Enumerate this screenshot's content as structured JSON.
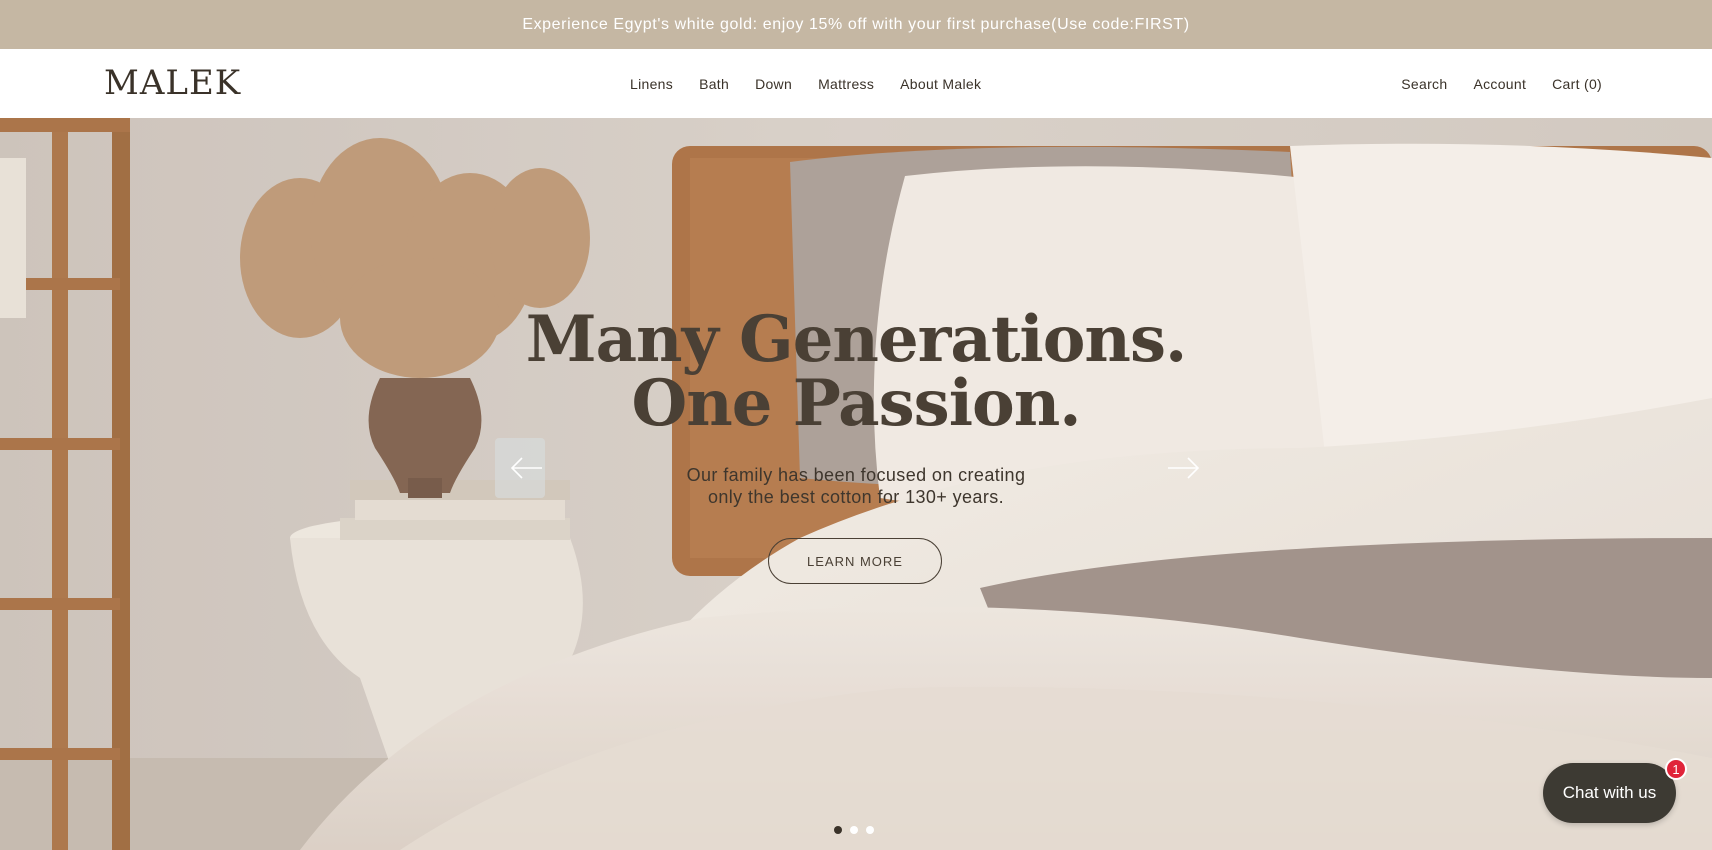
{
  "announcement": {
    "text": "Experience Egypt's white gold: enjoy 15% off with your first purchase(Use code:FIRST)"
  },
  "header": {
    "logo": "MALEK",
    "nav": [
      "Linens",
      "Bath",
      "Down",
      "Mattress",
      "About Malek"
    ],
    "util": {
      "search": "Search",
      "account": "Account",
      "cart": "Cart (0)"
    }
  },
  "hero": {
    "title_line1": "Many Generations.",
    "title_line2": "One Passion.",
    "subtitle_line1": "Our family has been focused on creating",
    "subtitle_line2": "only the best cotton for 130+ years.",
    "cta": "LEARN MORE",
    "slides_count": 3,
    "active_slide": 1,
    "image_icon": "bedroom-photo"
  },
  "chat": {
    "label": "Chat with us",
    "badge": "1"
  },
  "colors": {
    "announcement_bg": "#c5b7a3",
    "text_dark": "#3a3229",
    "chat_bg": "#3d3a33",
    "badge_red": "#e0243a"
  }
}
